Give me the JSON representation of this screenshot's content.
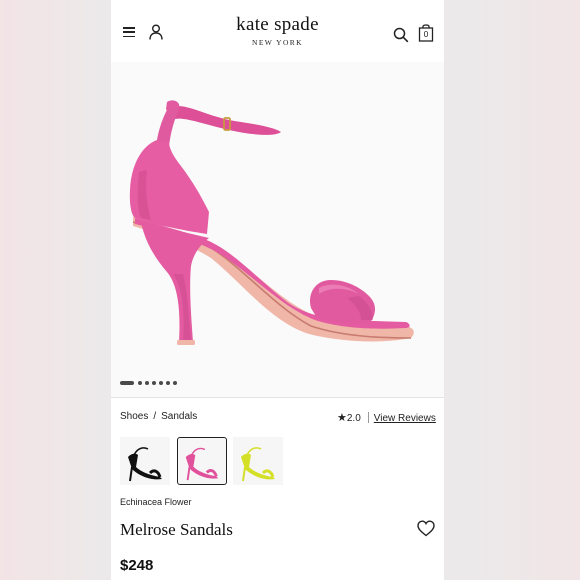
{
  "header": {
    "logo_main": "kate spade",
    "logo_sub": "NEW YORK",
    "bag_count": "0",
    "icons": [
      "menu-icon",
      "user-icon",
      "search-icon",
      "shopping-bag-icon"
    ]
  },
  "gallery": {
    "image_count": 7,
    "active_index": 0,
    "product_color": "#e0529b"
  },
  "breadcrumb": {
    "items": [
      "Shoes",
      "Sandals"
    ],
    "separator": "/"
  },
  "rating": {
    "value": "2.0",
    "reviews_link": "View Reviews"
  },
  "swatches": [
    {
      "color": "#111111",
      "selected": false
    },
    {
      "color": "#e0529b",
      "selected": true
    },
    {
      "color": "#d4e028",
      "selected": false
    }
  ],
  "product": {
    "color_name": "Echinacea Flower",
    "title": "Melrose Sandals",
    "price": "$248"
  }
}
